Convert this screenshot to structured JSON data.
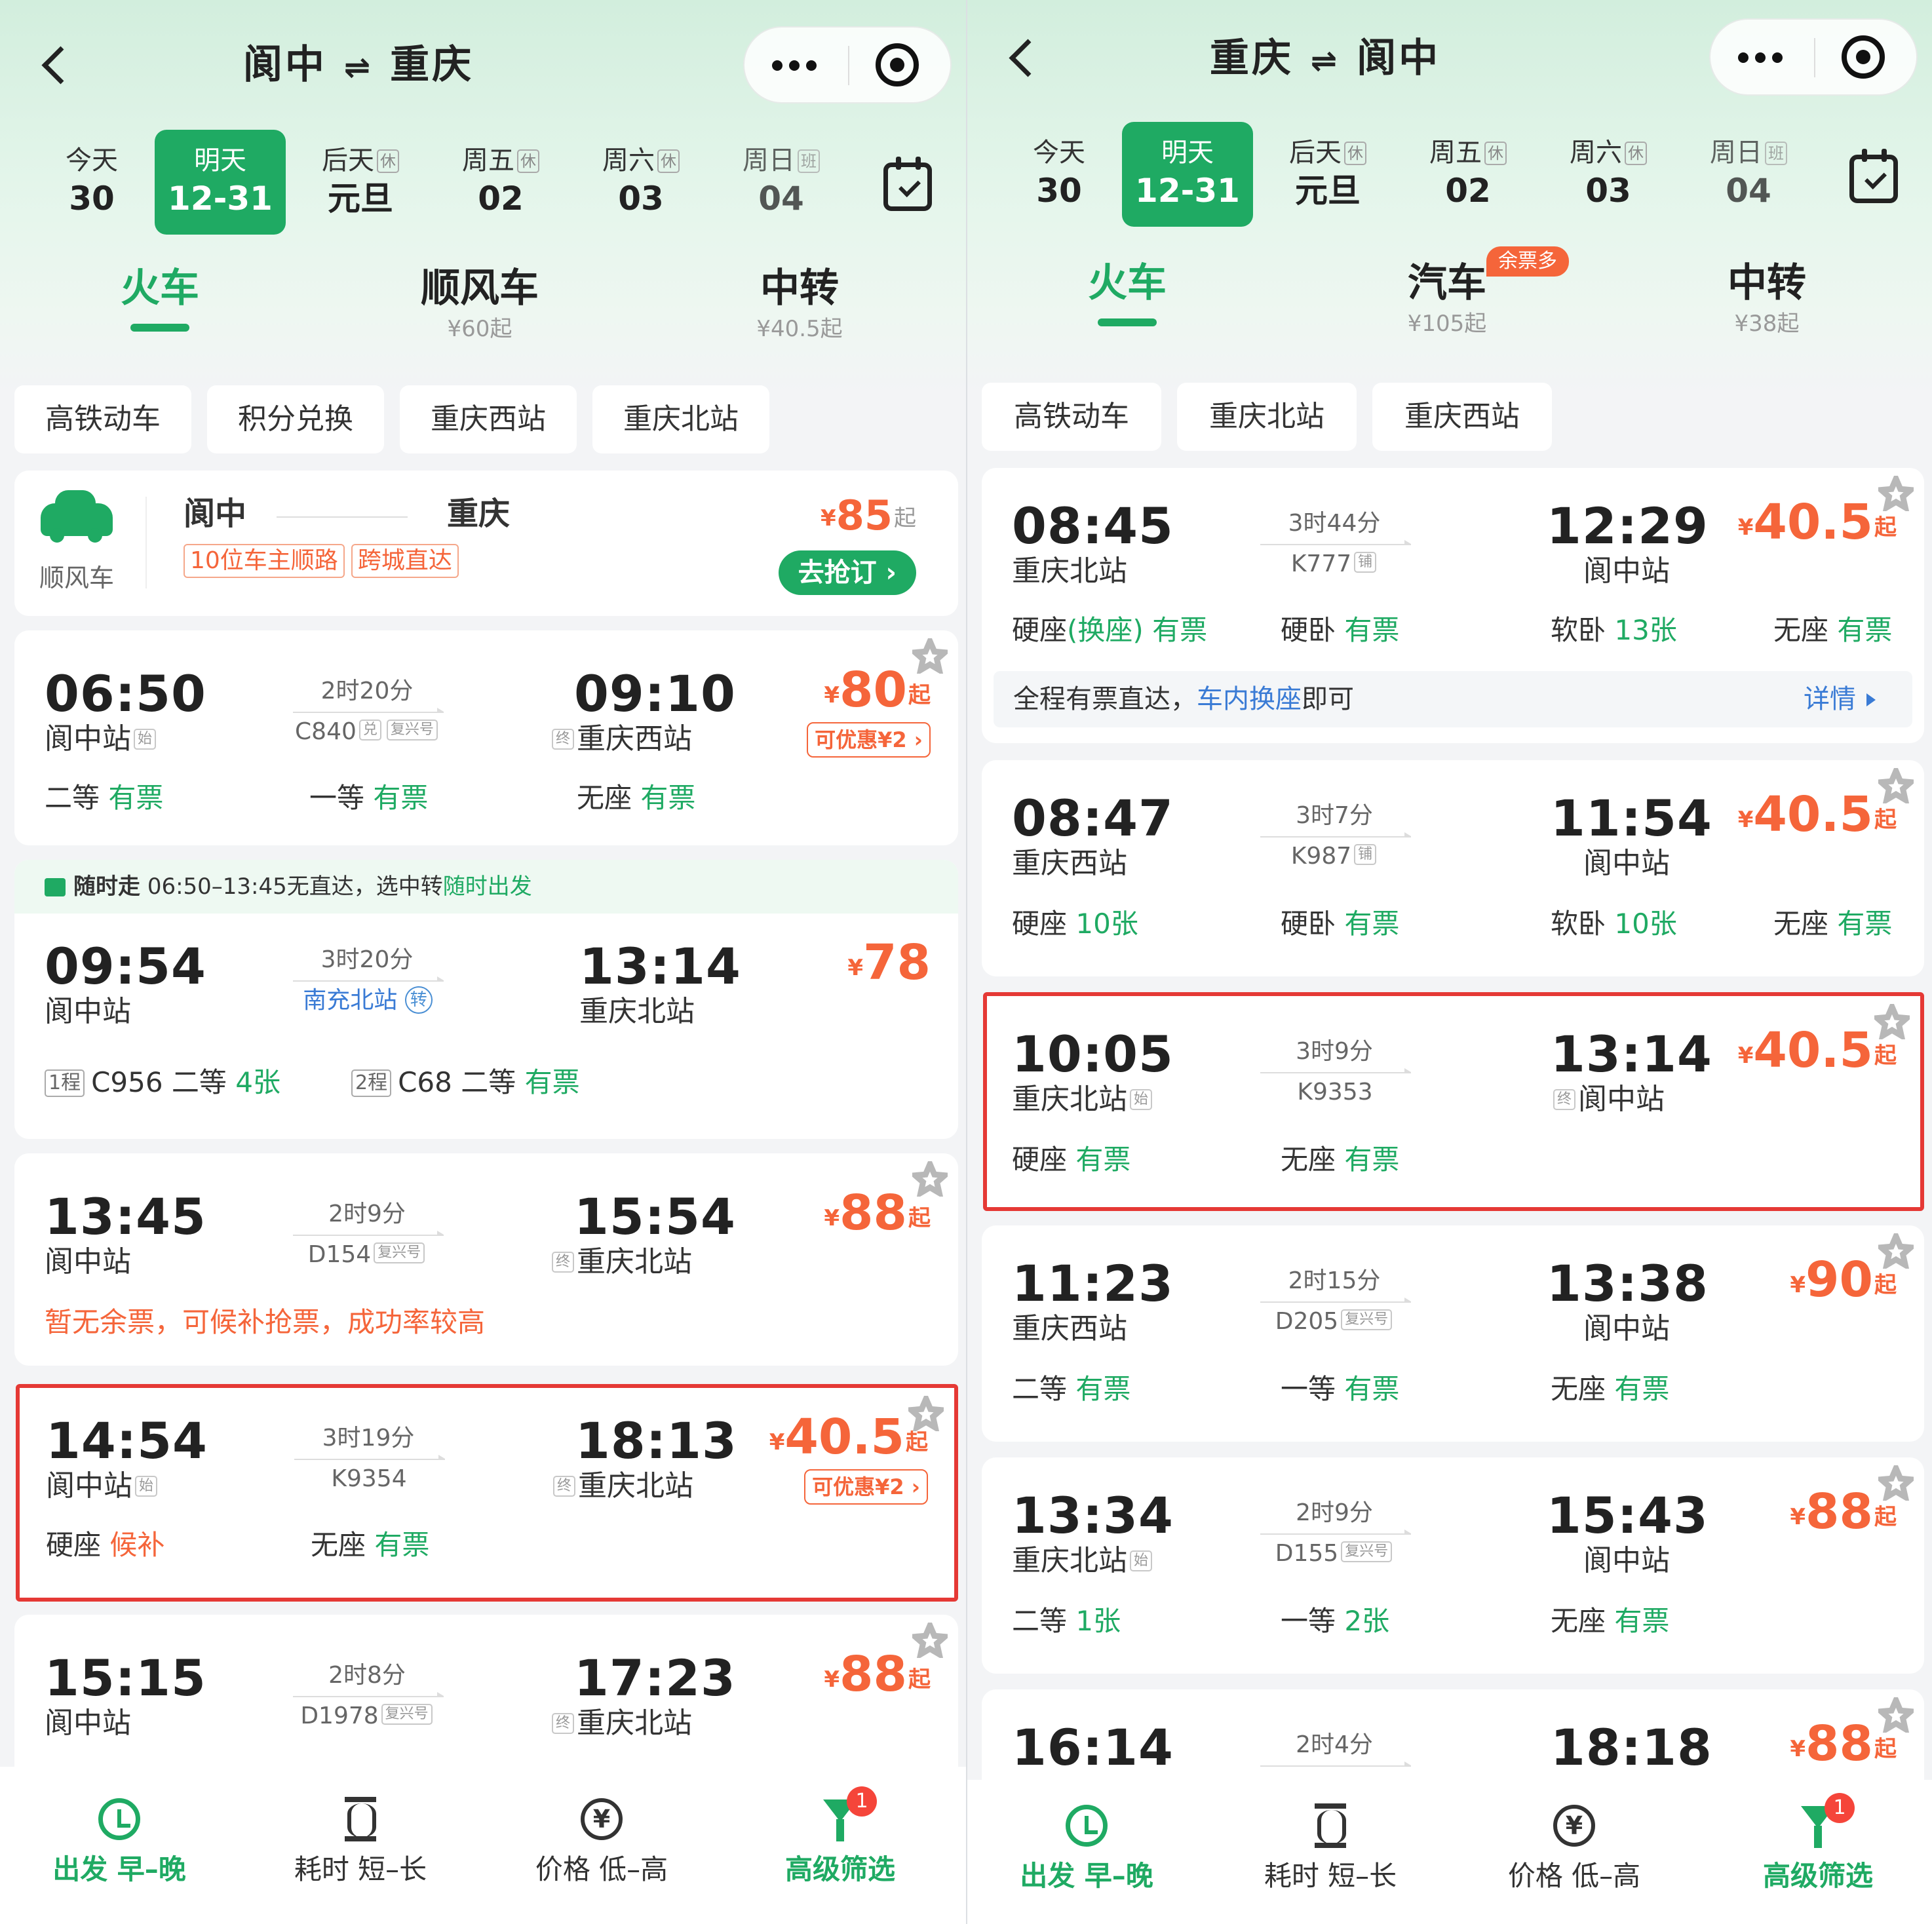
{
  "left": {
    "header": {
      "from": "阆中",
      "swap_icon": "⇌",
      "to": "重庆"
    },
    "dates": [
      {
        "d1": "今天",
        "tag": "",
        "d2": "30"
      },
      {
        "d1": "明天",
        "tag": "",
        "d2": "12-31"
      },
      {
        "d1": "后天",
        "tag": "休",
        "d2": "元旦"
      },
      {
        "d1": "周五",
        "tag": "休",
        "d2": "02"
      },
      {
        "d1": "周六",
        "tag": "休",
        "d2": "03"
      },
      {
        "d1": "周日",
        "tag": "班",
        "d2": "04"
      }
    ],
    "modes": [
      {
        "label": "火车",
        "sub": ""
      },
      {
        "label": "顺风车",
        "sub": "¥60起"
      },
      {
        "label": "中转",
        "sub": "¥40.5起"
      }
    ],
    "chips": [
      "高铁动车",
      "积分兑换",
      "重庆西站",
      "重庆北站"
    ],
    "ride": {
      "label": "顺风车",
      "from": "阆中",
      "to": "重庆",
      "badge1": "10位车主顺路",
      "badge2": "跨城直达",
      "yen": "¥",
      "price": "85",
      "qi": "起",
      "button": "去抢订",
      "arrow": "›"
    },
    "trains": [
      {
        "dep": "06:50",
        "dep_st": "阆中站",
        "dep_tag": "始",
        "dur": "2时20分",
        "no": "C840",
        "no_tag1": "兑",
        "no_tag2": "复兴号",
        "arr": "09:10",
        "arr_tag": "终",
        "arr_st": "重庆西站",
        "yen": "¥",
        "price": "80",
        "qi": "起",
        "discount": "可优惠¥2 ›",
        "seats": [
          {
            "name": "二等",
            "state": "有票"
          },
          {
            "name": "一等",
            "state": "有票"
          },
          {
            "name": "无座",
            "state": "有票"
          }
        ]
      },
      {
        "anytime_title": "随时走",
        "anytime_text": "06:50–13:45无直达，选中转",
        "anytime_link": "随时出发",
        "dep": "09:54",
        "dep_st": "阆中站",
        "dur": "3时20分",
        "via": "南充北站",
        "via_tag": "转",
        "arr": "13:14",
        "arr_st": "重庆北站",
        "yen": "¥",
        "price": "78",
        "leg1_tag": "1程",
        "leg1": "C956 二等",
        "leg1_state": "4张",
        "leg2_tag": "2程",
        "leg2": "C68 二等",
        "leg2_state": "有票"
      },
      {
        "dep": "13:45",
        "dep_st": "阆中站",
        "dur": "2时9分",
        "no": "D154",
        "no_tag2": "复兴号",
        "arr": "15:54",
        "arr_tag": "终",
        "arr_st": "重庆北站",
        "yen": "¥",
        "price": "88",
        "qi": "起",
        "note": "暂无余票，可候补抢票，成功率较高"
      },
      {
        "dep": "14:54",
        "dep_st": "阆中站",
        "dep_tag": "始",
        "dur": "3时19分",
        "no": "K9354",
        "arr": "18:13",
        "arr_tag": "终",
        "arr_st": "重庆北站",
        "yen": "¥",
        "price": "40.5",
        "qi": "起",
        "discount": "可优惠¥2 ›",
        "seats": [
          {
            "name": "硬座",
            "state": "候补"
          },
          {
            "name": "无座",
            "state": "有票"
          }
        ]
      },
      {
        "dep": "15:15",
        "dep_st": "阆中站",
        "dur": "2时8分",
        "no": "D1978",
        "no_tag2": "复兴号",
        "arr": "17:23",
        "arr_tag": "终",
        "arr_st": "重庆北站",
        "yen": "¥",
        "price": "88",
        "qi": "起"
      }
    ],
    "bottom": [
      {
        "label": "出发 早–晚"
      },
      {
        "label": "耗时 短–长"
      },
      {
        "label": "价格 低–高"
      },
      {
        "label": "高级筛选",
        "badge": "1"
      }
    ]
  },
  "right": {
    "header": {
      "from": "重庆",
      "swap_icon": "⇌",
      "to": "阆中"
    },
    "dates": [
      {
        "d1": "今天",
        "tag": "",
        "d2": "30"
      },
      {
        "d1": "明天",
        "tag": "",
        "d2": "12-31"
      },
      {
        "d1": "后天",
        "tag": "休",
        "d2": "元旦"
      },
      {
        "d1": "周五",
        "tag": "休",
        "d2": "02"
      },
      {
        "d1": "周六",
        "tag": "休",
        "d2": "03"
      },
      {
        "d1": "周日",
        "tag": "班",
        "d2": "04"
      }
    ],
    "modes": [
      {
        "label": "火车",
        "sub": ""
      },
      {
        "label": "汽车",
        "sub": "¥105起",
        "badge": "余票多"
      },
      {
        "label": "中转",
        "sub": "¥38起"
      }
    ],
    "chips": [
      "高铁动车",
      "重庆北站",
      "重庆西站"
    ],
    "trains": [
      {
        "dep": "08:45",
        "dep_st": "重庆北站",
        "dur": "3时44分",
        "no": "K777",
        "no_tag": "铺",
        "arr": "12:29",
        "arr_st": "阆中站",
        "yen": "¥",
        "price": "40.5",
        "qi": "起",
        "seats": [
          {
            "name": "硬座",
            "name2": "(换座)",
            "state": "有票"
          },
          {
            "name": "硬卧",
            "state": "有票"
          },
          {
            "name": "软卧",
            "state": "13张"
          },
          {
            "name": "无座",
            "state": "有票"
          }
        ],
        "tip_a": "全程有票直达，",
        "tip_link": "车内换座",
        "tip_b": "即可",
        "detail": "详情"
      },
      {
        "dep": "08:47",
        "dep_st": "重庆西站",
        "dur": "3时7分",
        "no": "K987",
        "no_tag": "铺",
        "arr": "11:54",
        "arr_st": "阆中站",
        "yen": "¥",
        "price": "40.5",
        "qi": "起",
        "seats": [
          {
            "name": "硬座",
            "state": "10张"
          },
          {
            "name": "硬卧",
            "state": "有票"
          },
          {
            "name": "软卧",
            "state": "10张"
          },
          {
            "name": "无座",
            "state": "有票"
          }
        ]
      },
      {
        "dep": "10:05",
        "dep_st": "重庆北站",
        "dep_tag": "始",
        "dur": "3时9分",
        "no": "K9353",
        "arr": "13:14",
        "arr_tag": "终",
        "arr_st": "阆中站",
        "yen": "¥",
        "price": "40.5",
        "qi": "起",
        "seats": [
          {
            "name": "硬座",
            "state": "有票"
          },
          {
            "name": "无座",
            "state": "有票"
          }
        ]
      },
      {
        "dep": "11:23",
        "dep_st": "重庆西站",
        "dur": "2时15分",
        "no": "D205",
        "no_tag": "复兴号",
        "arr": "13:38",
        "arr_st": "阆中站",
        "yen": "¥",
        "price": "90",
        "qi": "起",
        "seats": [
          {
            "name": "二等",
            "state": "有票"
          },
          {
            "name": "一等",
            "state": "有票"
          },
          {
            "name": "无座",
            "state": "有票"
          }
        ]
      },
      {
        "dep": "13:34",
        "dep_st": "重庆北站",
        "dep_tag": "始",
        "dur": "2时9分",
        "no": "D155",
        "no_tag": "复兴号",
        "arr": "15:43",
        "arr_st": "阆中站",
        "yen": "¥",
        "price": "88",
        "qi": "起",
        "seats": [
          {
            "name": "二等",
            "state": "1张"
          },
          {
            "name": "一等",
            "state": "2张"
          },
          {
            "name": "无座",
            "state": "有票"
          }
        ]
      },
      {
        "dep": "16:14",
        "dur": "2时4分",
        "arr": "18:18",
        "yen": "¥",
        "price": "88",
        "qi": "起"
      }
    ],
    "bottom": [
      {
        "label": "出发 早–晚"
      },
      {
        "label": "耗时 短–长"
      },
      {
        "label": "价格 低–高"
      },
      {
        "label": "高级筛选",
        "badge": "1"
      }
    ]
  },
  "colors": {
    "accent": "#1faa63",
    "price": "#f5653a",
    "highlight_border": "#e53935",
    "link": "#3a7bd5"
  },
  "icons": [
    "back-icon",
    "more-icon",
    "close-icon",
    "calendar-icon",
    "car-icon",
    "star-icon",
    "clock-icon",
    "hourglass-icon",
    "yen-icon",
    "filter-icon",
    "thumb-icon"
  ]
}
